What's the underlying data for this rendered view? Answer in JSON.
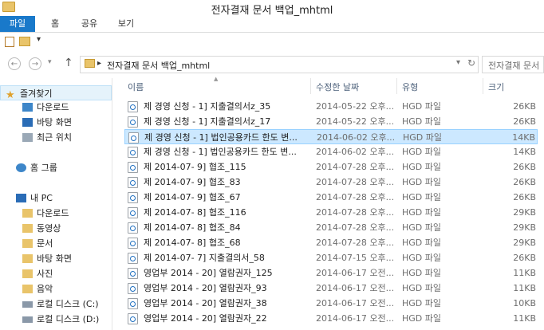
{
  "window": {
    "title": "전자결재 문서 백업_mhtml"
  },
  "ribbon": {
    "tabs": [
      {
        "label": "파일"
      },
      {
        "label": "홈"
      },
      {
        "label": "공유"
      },
      {
        "label": "보기"
      }
    ]
  },
  "address": {
    "breadcrumb": "전자결재 문서 백업_mhtml",
    "separator": "▸"
  },
  "search": {
    "placeholder": "전자결재 문서"
  },
  "nav": {
    "favorites": {
      "label": "즐겨찾기",
      "items": [
        {
          "label": "다운로드"
        },
        {
          "label": "바탕 화면"
        },
        {
          "label": "최근 위치"
        }
      ]
    },
    "homegroup": {
      "label": "홈 그룹"
    },
    "pc": {
      "label": "내 PC",
      "items": [
        {
          "label": "다운로드"
        },
        {
          "label": "동영상"
        },
        {
          "label": "문서"
        },
        {
          "label": "바탕 화면"
        },
        {
          "label": "사진"
        },
        {
          "label": "음악"
        },
        {
          "label": "로컬 디스크 (C:)"
        },
        {
          "label": "로컬 디스크 (D:)"
        }
      ]
    }
  },
  "columns": {
    "name": "이름",
    "date": "수정한 날짜",
    "type": "유형",
    "size": "크기"
  },
  "files": [
    {
      "name": "제 경영 신청 - 1] 지출결의서z_35",
      "date": "2014-05-22 오후...",
      "type": "HGD 파일",
      "size": "26KB"
    },
    {
      "name": "제 경영 신청 - 1] 지출결의서z_17",
      "date": "2014-05-22 오후...",
      "type": "HGD 파일",
      "size": "26KB"
    },
    {
      "name": "제 경영 신청 - 1] 법인공용카드 한도 변...",
      "date": "2014-06-02 오후...",
      "type": "HGD 파일",
      "size": "14KB",
      "selected": true
    },
    {
      "name": "제 경영 신청 - 1] 법인공용카드 한도 변...",
      "date": "2014-06-02 오후...",
      "type": "HGD 파일",
      "size": "14KB"
    },
    {
      "name": "제 2014-07- 9] 협조_115",
      "date": "2014-07-28 오후...",
      "type": "HGD 파일",
      "size": "26KB"
    },
    {
      "name": "제 2014-07- 9] 협조_83",
      "date": "2014-07-28 오후...",
      "type": "HGD 파일",
      "size": "26KB"
    },
    {
      "name": "제 2014-07- 9] 협조_67",
      "date": "2014-07-28 오후...",
      "type": "HGD 파일",
      "size": "26KB"
    },
    {
      "name": "제 2014-07- 8] 협조_116",
      "date": "2014-07-28 오후...",
      "type": "HGD 파일",
      "size": "29KB"
    },
    {
      "name": "제 2014-07- 8] 협조_84",
      "date": "2014-07-28 오후...",
      "type": "HGD 파일",
      "size": "29KB"
    },
    {
      "name": "제 2014-07- 8] 협조_68",
      "date": "2014-07-28 오후...",
      "type": "HGD 파일",
      "size": "29KB"
    },
    {
      "name": "제 2014-07- 7] 지출결의서_58",
      "date": "2014-07-15 오후...",
      "type": "HGD 파일",
      "size": "26KB"
    },
    {
      "name": "영업부 2014 - 20] 열람권자_125",
      "date": "2014-06-17 오전...",
      "type": "HGD 파일",
      "size": "11KB"
    },
    {
      "name": "영업부 2014 - 20] 열람권자_93",
      "date": "2014-06-17 오전...",
      "type": "HGD 파일",
      "size": "11KB"
    },
    {
      "name": "영업부 2014 - 20] 열람권자_38",
      "date": "2014-06-17 오전...",
      "type": "HGD 파일",
      "size": "10KB"
    },
    {
      "name": "영업부 2014 - 20] 열람권자_22",
      "date": "2014-06-17 오전...",
      "type": "HGD 파일",
      "size": "11KB"
    }
  ]
}
